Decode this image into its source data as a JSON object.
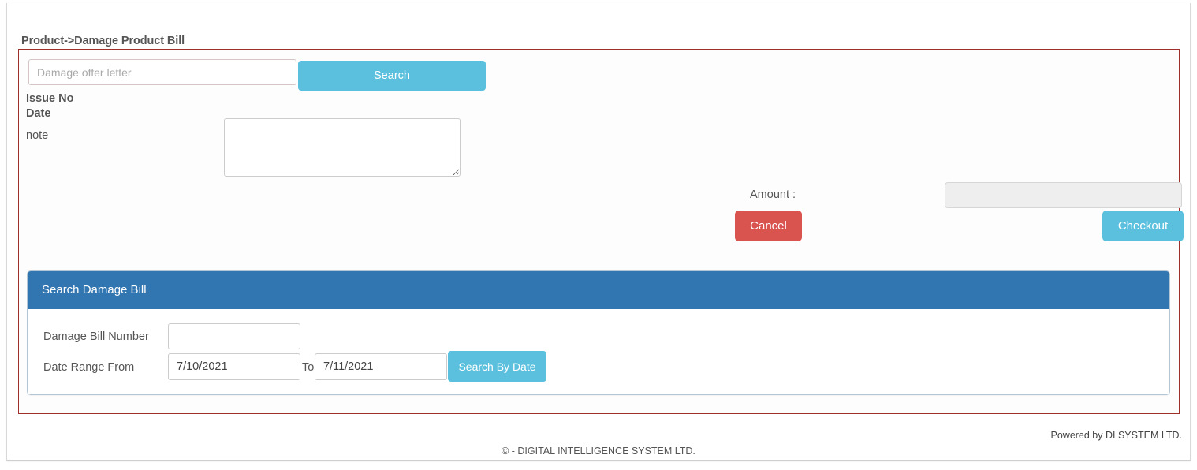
{
  "page": {
    "title": "Product->Damage Product Bill"
  },
  "offer_search": {
    "placeholder": "Damage offer letter",
    "value": "",
    "search_label": "Search"
  },
  "bill_fields": {
    "issue_no_label": "Issue No",
    "date_label": "Date",
    "note_label": "note",
    "note_value": ""
  },
  "amount_section": {
    "amount_label": "Amount :",
    "amount_value": "",
    "cancel_label": "Cancel",
    "checkout_label": "Checkout"
  },
  "search_panel": {
    "heading": "Search Damage Bill",
    "bill_number_label": "Damage Bill Number",
    "bill_number_value": "",
    "date_range_label": "Date Range From",
    "date_from_value": "7/10/2021",
    "to_label": "To",
    "date_to_value": "7/11/2021",
    "search_by_date_label": "Search By Date"
  },
  "footer": {
    "powered_by": "Powered by DI SYSTEM LTD.",
    "copyright": "©  - DIGITAL INTELLIGENCE SYSTEM LTD."
  },
  "colors": {
    "info_blue": "#5bc0de",
    "panel_header_blue": "#3276b1",
    "danger_red": "#d9534f",
    "panel_border_red": "#9e2f2a",
    "disabled_gray": "#eeeeee"
  }
}
